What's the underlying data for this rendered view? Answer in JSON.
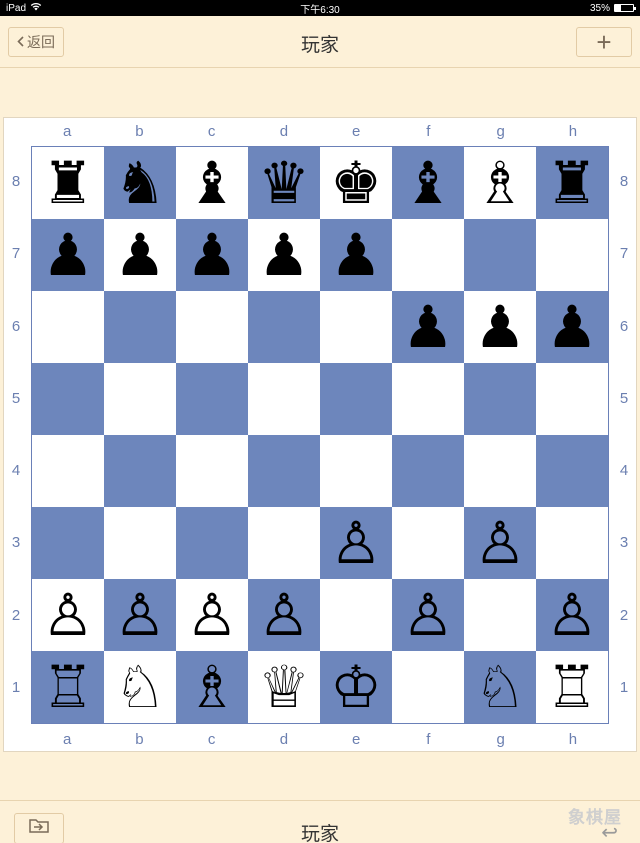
{
  "status_bar": {
    "device": "iPad",
    "time": "下午6:30",
    "battery_text": "35%",
    "battery_level": 0.35
  },
  "nav": {
    "back_label": "返回",
    "title": "玩家",
    "add_label": "+"
  },
  "board": {
    "files": [
      "a",
      "b",
      "c",
      "d",
      "e",
      "f",
      "g",
      "h"
    ],
    "ranks": [
      "8",
      "7",
      "6",
      "5",
      "4",
      "3",
      "2",
      "1"
    ],
    "colors": {
      "dark": "#6d86bc",
      "light": "#ffffff"
    },
    "rows": [
      [
        "r",
        "n",
        "b",
        "q",
        "k",
        "b",
        "B",
        "r"
      ],
      [
        "p",
        "p",
        "p",
        "p",
        "p",
        "",
        "",
        ""
      ],
      [
        "",
        "",
        "",
        "",
        "",
        "p",
        "p",
        "p"
      ],
      [
        "",
        "",
        "",
        "",
        "",
        "",
        "",
        ""
      ],
      [
        "",
        "",
        "",
        "",
        "",
        "",
        "",
        ""
      ],
      [
        "",
        "",
        "",
        "",
        "P",
        "",
        "P",
        ""
      ],
      [
        "P",
        "P",
        "P",
        "P",
        "",
        "P",
        "",
        "P"
      ],
      [
        "R",
        "N",
        "B",
        "Q",
        "K",
        "",
        "N",
        "R"
      ]
    ]
  },
  "bottom": {
    "title": "玩家",
    "import_icon": "import-icon",
    "watermark": "象棋屋"
  }
}
